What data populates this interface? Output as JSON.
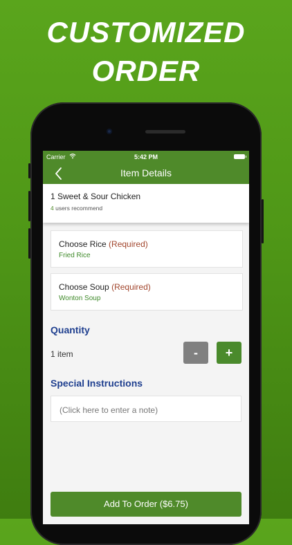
{
  "promo": {
    "line1": "CUSTOMIZED",
    "line2": "ORDER"
  },
  "status_bar": {
    "carrier": "Carrier",
    "wifi_icon": "wifi-icon",
    "time": "5:42 PM",
    "battery_icon": "battery-icon"
  },
  "nav": {
    "back_icon": "chevron-left-icon",
    "title": "Item Details"
  },
  "item": {
    "name": "1 Sweet & Sour Chicken",
    "recommend_count": "4",
    "recommend_text": " users recommend"
  },
  "options": [
    {
      "title": "Choose Rice",
      "required": "(Required)",
      "value": "Fried Rice"
    },
    {
      "title": "Choose Soup",
      "required": "(Required)",
      "value": "Wonton Soup"
    }
  ],
  "quantity": {
    "label": "Quantity",
    "value_text": "1 item",
    "minus_label": "-",
    "plus_label": "+"
  },
  "instructions": {
    "label": "Special Instructions",
    "placeholder": "(Click here to enter a note)"
  },
  "order_button": {
    "label": "Add To Order ($6.75)"
  },
  "colors": {
    "brand_green": "#4f8a2a",
    "required_red": "#a1452c",
    "section_blue": "#1f3f8f",
    "minus_gray": "#808080"
  }
}
